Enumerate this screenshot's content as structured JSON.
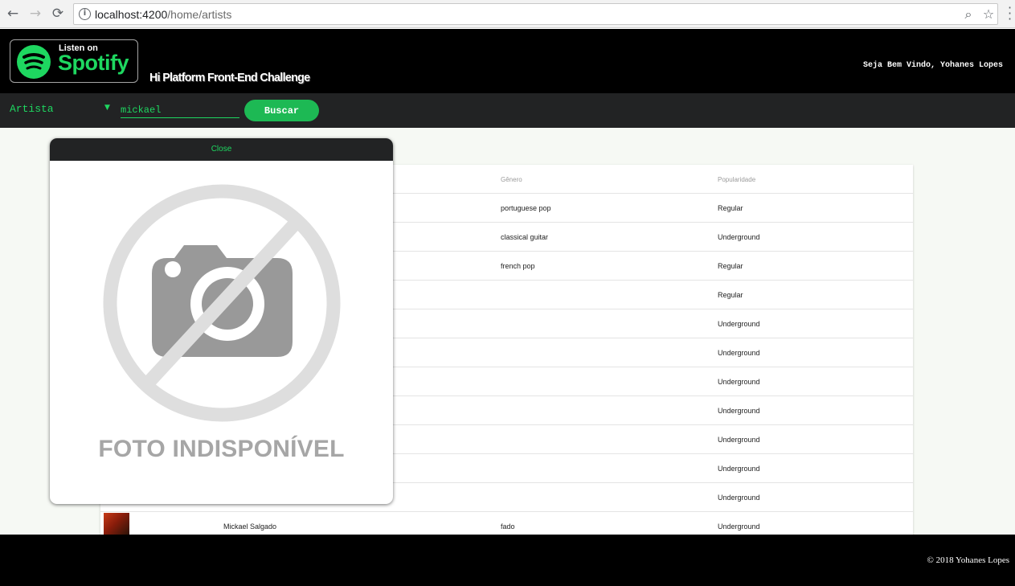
{
  "browser": {
    "url_host": "localhost:4200",
    "url_path": "/home/artists",
    "icons": [
      "back-icon",
      "forward-icon",
      "reload-icon",
      "info-icon",
      "zoom-icon",
      "star-icon",
      "menu-icon"
    ]
  },
  "header": {
    "badge_listen_on": "Listen on",
    "badge_brand": "Spotify",
    "title": "Hi Platform Front-End Challenge",
    "welcome": "Seja Bem Vindo, Yohanes Lopes"
  },
  "search": {
    "type_selected": "Artista",
    "query": "mickael",
    "button_label": "Buscar"
  },
  "table": {
    "headers": {
      "genre": "Gênero",
      "popularity": "Popularidade"
    },
    "rows": [
      {
        "name": "",
        "genre": "portuguese pop",
        "popularity": "Regular"
      },
      {
        "name": "",
        "genre": "classical guitar",
        "popularity": "Underground"
      },
      {
        "name": "",
        "genre": "french pop",
        "popularity": "Regular"
      },
      {
        "name": "",
        "genre": "",
        "popularity": "Regular"
      },
      {
        "name": "",
        "genre": "",
        "popularity": "Underground"
      },
      {
        "name": "",
        "genre": "",
        "popularity": "Underground"
      },
      {
        "name": "",
        "genre": "",
        "popularity": "Underground"
      },
      {
        "name": "",
        "genre": "",
        "popularity": "Underground"
      },
      {
        "name": "",
        "genre": "",
        "popularity": "Underground"
      },
      {
        "name": "",
        "genre": "",
        "popularity": "Underground"
      },
      {
        "name": "",
        "genre": "",
        "popularity": "Underground"
      },
      {
        "name": "Mickael Salgado",
        "genre": "fado",
        "popularity": "Underground"
      }
    ]
  },
  "modal": {
    "close_label": "Close",
    "no_photo_text": "FOTO INDISPONÍVEL"
  },
  "footer": {
    "text": "© 2018 Yohanes Lopes"
  },
  "colors": {
    "accent": "#1ed760",
    "button": "#1db954",
    "header_bg": "#000000",
    "bar_bg": "#222324"
  }
}
